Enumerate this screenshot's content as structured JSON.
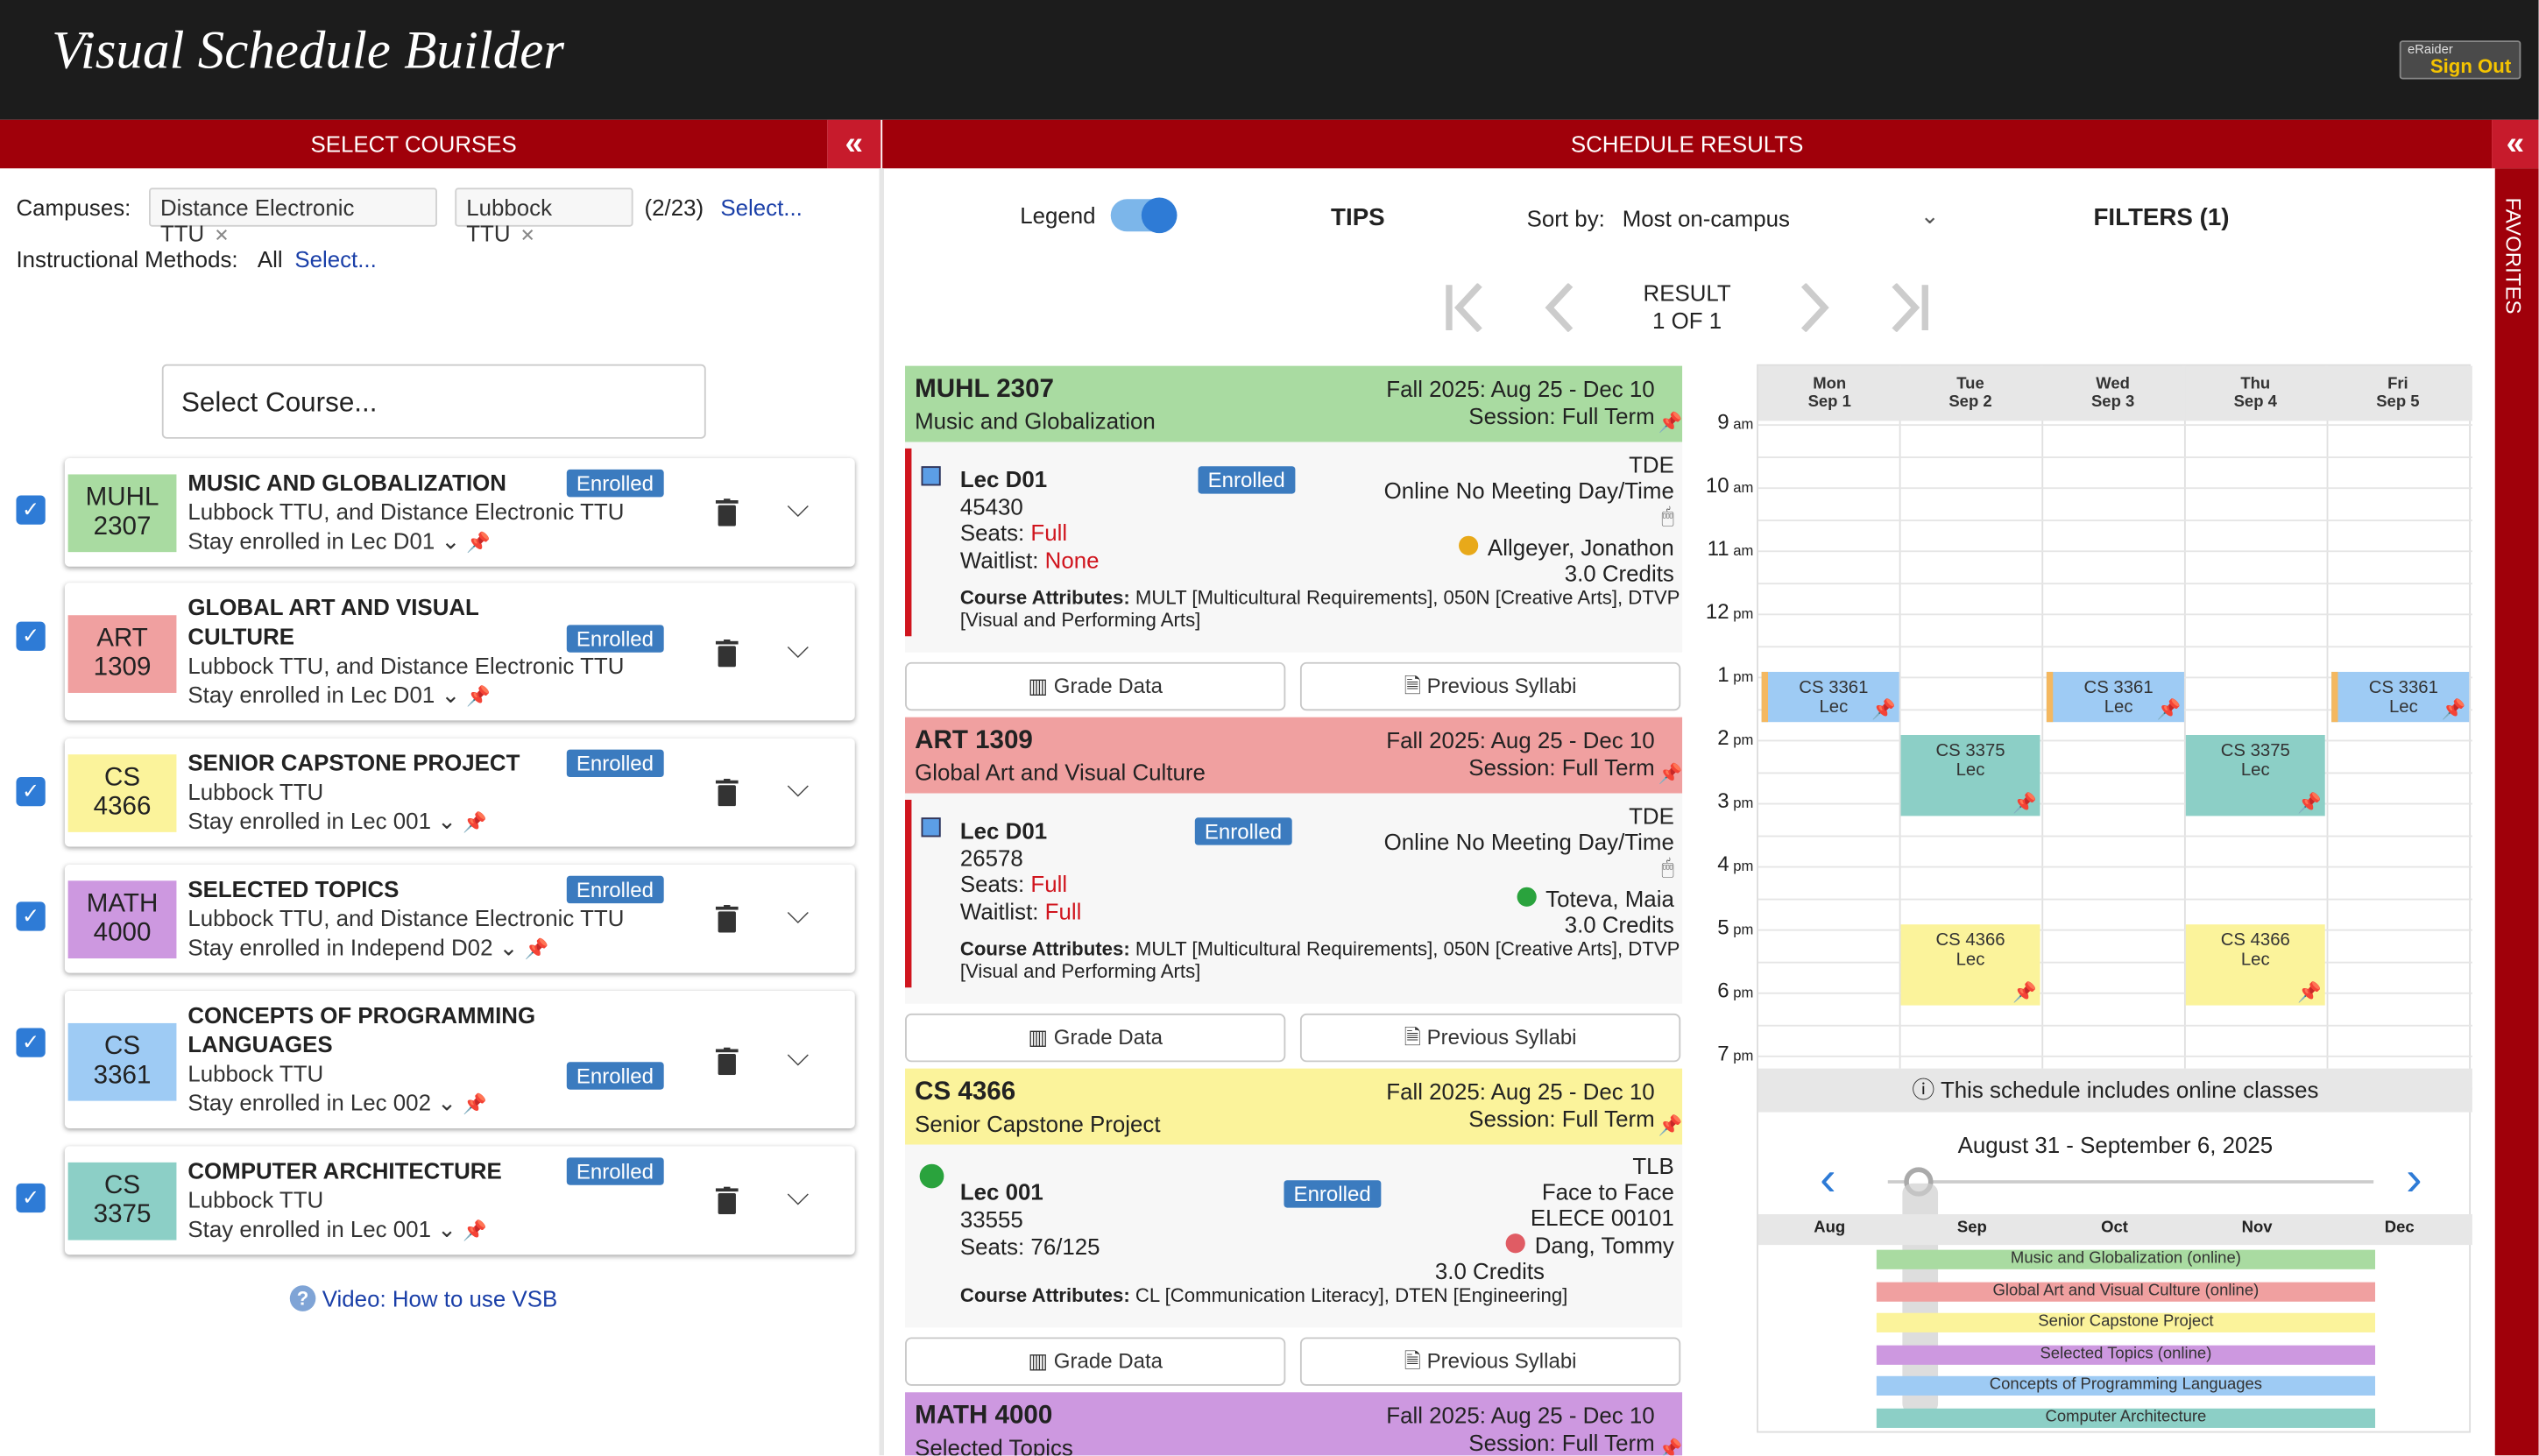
{
  "app": {
    "title": "Visual Schedule Builder",
    "signout_small": "eRaider",
    "signout": "Sign Out"
  },
  "left": {
    "header": "SELECT COURSES",
    "collapse": "«",
    "campuses_label": "Campuses:",
    "campus_tags": [
      "Distance Electronic TTU",
      "Lubbock TTU"
    ],
    "campus_count": "(2/23)",
    "select_link": "Select...",
    "methods_label": "Instructional Methods:",
    "methods_value": "All",
    "methods_link": "Select...",
    "select_course": "Select Course...",
    "courses": [
      {
        "code1": "MUHL",
        "code2": "2307",
        "title": "MUSIC AND GLOBALIZATION",
        "campus": "Lubbock TTU, and Distance Electronic TTU",
        "stay": "Stay enrolled in Lec D01",
        "status": "Enrolled",
        "color": "#a9dba1"
      },
      {
        "code1": "ART",
        "code2": "1309",
        "title": "GLOBAL ART AND VISUAL CULTURE",
        "campus": "Lubbock TTU, and Distance Electronic TTU",
        "stay": "Stay enrolled in Lec D01",
        "status": "Enrolled",
        "color": "#f0a0a0"
      },
      {
        "code1": "CS",
        "code2": "4366",
        "title": "SENIOR CAPSTONE PROJECT",
        "campus": "Lubbock TTU",
        "stay": "Stay enrolled in Lec 001",
        "status": "Enrolled",
        "color": "#fbf39b"
      },
      {
        "code1": "MATH",
        "code2": "4000",
        "title": "SELECTED TOPICS",
        "campus": "Lubbock TTU, and Distance Electronic TTU",
        "stay": "Stay enrolled in Independ D02",
        "status": "Enrolled",
        "color": "#cd98e0"
      },
      {
        "code1": "CS",
        "code2": "3361",
        "title": "CONCEPTS OF PROGRAMMING",
        "title2": "LANGUAGES",
        "campus": "Lubbock TTU",
        "stay": "Stay enrolled in Lec 002",
        "status": "Enrolled",
        "color": "#9ecbf4"
      },
      {
        "code1": "CS",
        "code2": "3375",
        "title": "COMPUTER ARCHITECTURE",
        "campus": "Lubbock TTU",
        "stay": "Stay enrolled in Lec 001",
        "status": "Enrolled",
        "color": "#8ccfc6"
      }
    ],
    "video_link": "Video: How to use VSB"
  },
  "right": {
    "header": "SCHEDULE RESULTS",
    "collapse": "«",
    "favorites": "FAVORITES",
    "legend_label": "Legend",
    "tips": "TIPS",
    "sort_label": "Sort by:",
    "sort_value": "Most on-campus",
    "filters": "FILTERS (1)",
    "result_label": "RESULT",
    "result_count": "1 OF 1",
    "result_cards": [
      {
        "code": "MUHL 2307",
        "name": "Music and Globalization",
        "term": "Fall 2025: Aug 25 - Dec 10",
        "session": "Session: Full Term",
        "section": "Lec D01",
        "crn": "45430",
        "seats_label": "Seats:",
        "seats": "Full",
        "waitlist_label": "Waitlist:",
        "waitlist": "None",
        "status": "Enrolled",
        "campus": "TDE",
        "meeting": "Online No Meeting Day/Time",
        "instructor": "Allgeyer, Jonathon",
        "credits": "3.0 Credits",
        "attr_label": "Course Attributes:",
        "attr": "MULT [Multicultural Requirements], 050N [Creative Arts], DTVP",
        "attr2": "[Visual and Performing Arts]",
        "color": "#a9dba1"
      },
      {
        "code": "ART 1309",
        "name": "Global Art and Visual Culture",
        "term": "Fall 2025: Aug 25 - Dec 10",
        "session": "Session: Full Term",
        "section": "Lec D01",
        "crn": "26578",
        "seats_label": "Seats:",
        "seats": "Full",
        "waitlist_label": "Waitlist:",
        "waitlist": "Full",
        "status": "Enrolled",
        "campus": "TDE",
        "meeting": "Online No Meeting Day/Time",
        "instructor": "Toteva, Maia",
        "credits": "3.0 Credits",
        "attr_label": "Course Attributes:",
        "attr": "MULT [Multicultural Requirements], 050N [Creative Arts], DTVP",
        "attr2": "[Visual and Performing Arts]",
        "color": "#f0a0a0"
      },
      {
        "code": "CS 4366",
        "name": "Senior Capstone Project",
        "term": "Fall 2025: Aug 25 - Dec 10",
        "session": "Session: Full Term",
        "section": "Lec 001",
        "crn": "33555",
        "seats_label": "Seats:",
        "seats": "76/125",
        "status": "Enrolled",
        "campus": "TLB",
        "meeting": "Face to Face",
        "room": "ELECE 00101",
        "instructor": "Dang, Tommy",
        "credits": "3.0 Credits",
        "attr_label": "Course Attributes:",
        "attr": "CL [Communication Literacy], DTEN [Engineering]",
        "color": "#fbf39b"
      },
      {
        "code": "MATH 4000",
        "name": "Selected Topics",
        "term": "Fall 2025: Aug 25 - Dec 10",
        "session": "Session: Full Term",
        "color": "#cd98e0"
      }
    ],
    "grade_data": "Grade Data",
    "prev_syllabi": "Previous Syllabi",
    "days": [
      {
        "d": "Mon",
        "date": "Sep 1"
      },
      {
        "d": "Tue",
        "date": "Sep 2"
      },
      {
        "d": "Wed",
        "date": "Sep 3"
      },
      {
        "d": "Thu",
        "date": "Sep 4"
      },
      {
        "d": "Fri",
        "date": "Sep 5"
      }
    ],
    "times": [
      {
        "h": "9",
        "ap": "am"
      },
      {
        "h": "10",
        "ap": "am"
      },
      {
        "h": "11",
        "ap": "am"
      },
      {
        "h": "12",
        "ap": "pm"
      },
      {
        "h": "1",
        "ap": "pm"
      },
      {
        "h": "2",
        "ap": "pm"
      },
      {
        "h": "3",
        "ap": "pm"
      },
      {
        "h": "4",
        "ap": "pm"
      },
      {
        "h": "5",
        "ap": "pm"
      },
      {
        "h": "6",
        "ap": "pm"
      },
      {
        "h": "7",
        "ap": "pm"
      }
    ],
    "events": {
      "cs3361": "CS 3361",
      "cs3375": "CS 3375",
      "cs4366": "CS 4366",
      "lec": "Lec"
    },
    "online_note": "This schedule includes online classes",
    "week_range": "August 31 - September 6, 2025",
    "months": [
      "Aug",
      "Sep",
      "Oct",
      "Nov",
      "Dec"
    ],
    "gantt": [
      "Music and Globalization (online)",
      "Global Art and Visual Culture (online)",
      "Senior Capstone Project",
      "Selected Topics (online)",
      "Concepts of Programming Languages",
      "Computer Architecture"
    ]
  }
}
